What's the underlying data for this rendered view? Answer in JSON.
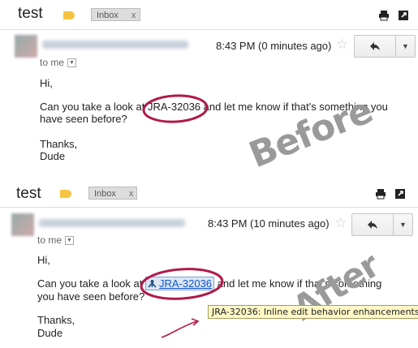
{
  "before": {
    "subject": "test",
    "label_chip": "Inbox",
    "chip_close": "x",
    "time": "8:43 PM (0 minutes ago)",
    "to_me": "to me",
    "body": {
      "greeting": "Hi,",
      "line1_pre": "Can you take a look at ",
      "issue_key": "JRA-32036",
      "line1_post": " and let me know if that's something you",
      "line2": "have seen before?",
      "thanks": "Thanks,",
      "signature": "Dude"
    },
    "watermark": "Before"
  },
  "after": {
    "subject": "test",
    "label_chip": "Inbox",
    "chip_close": "x",
    "time": "8:43 PM (10 minutes ago)",
    "to_me": "to me",
    "body": {
      "greeting": "Hi,",
      "line1_pre": "Can you take a look at ",
      "issue_key": "JRA-32036",
      "line1_post": " and let me know if that's something",
      "line2": "you have seen before?",
      "thanks": "Thanks,",
      "signature": "Dude"
    },
    "tooltip": "JRA-32036: Inline edit behavior enhancements",
    "watermark": "After"
  },
  "colors": {
    "annotation": "#b01a4a",
    "link": "#1155cc",
    "tag": "#f5c342",
    "tooltip_bg": "#fff8c6"
  },
  "icons": [
    "label-tag-icon",
    "print-icon",
    "new-window-icon",
    "star-icon",
    "reply-icon",
    "dropdown-arrow-icon",
    "jira-icon"
  ]
}
